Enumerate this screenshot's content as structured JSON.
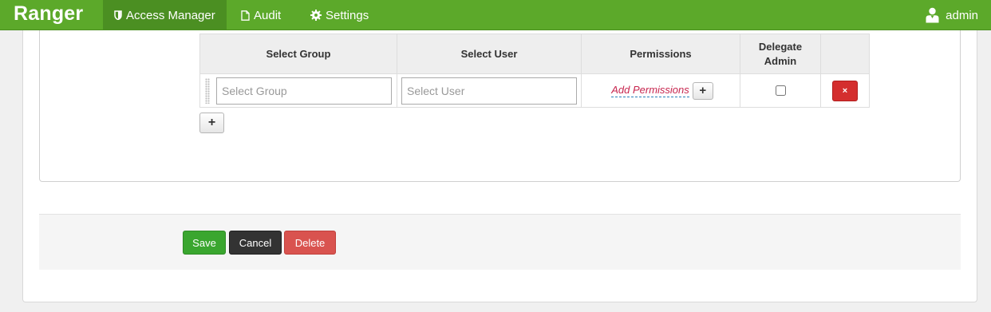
{
  "navbar": {
    "brand": "Ranger",
    "items": [
      {
        "label": "Access Manager",
        "icon": "shield-icon",
        "active": true
      },
      {
        "label": "Audit",
        "icon": "document-icon",
        "active": false
      },
      {
        "label": "Settings",
        "icon": "gear-icon",
        "active": false
      }
    ],
    "user": {
      "label": "admin",
      "icon": "user-icon"
    }
  },
  "table": {
    "headers": {
      "group": "Select Group",
      "user": "Select User",
      "permissions": "Permissions",
      "delegate_line1": "Delegate",
      "delegate_line2": "Admin"
    },
    "rows": [
      {
        "group_placeholder": "Select Group",
        "user_placeholder": "Select User",
        "permissions_link": "Add Permissions",
        "delegate_admin": false
      }
    ],
    "add_perm_button": "+",
    "delete_row_button": "×",
    "add_row_button": "+"
  },
  "actions": {
    "save": "Save",
    "cancel": "Cancel",
    "delete": "Delete"
  },
  "colors": {
    "navbar": "#5ca92a",
    "navbar_active": "#4b8f22",
    "save": "#3aa62f",
    "cancel": "#333333",
    "delete": "#d9534f",
    "permission_link": "#c7254e"
  }
}
